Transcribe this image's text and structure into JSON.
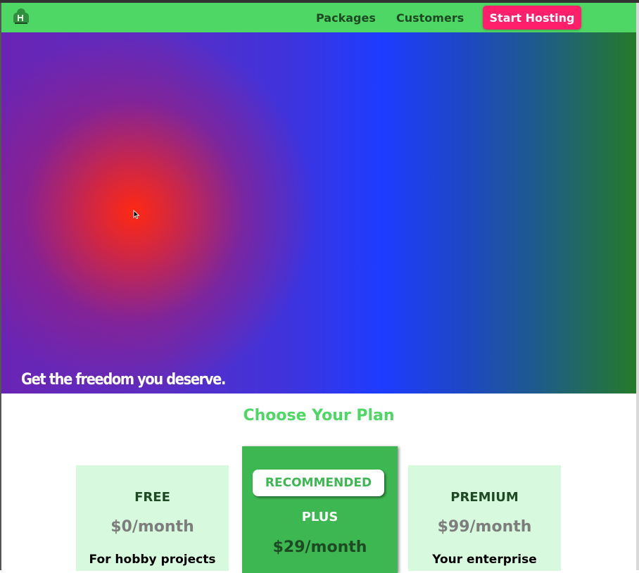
{
  "nav": {
    "logo_icon": "house-cloud-logo-icon",
    "links": [
      "Packages",
      "Customers"
    ],
    "cta_label": "Start Hosting"
  },
  "hero": {
    "title": "Get the freedom you deserve."
  },
  "plans": {
    "heading": "Choose Your Plan",
    "free": {
      "name": "FREE",
      "price": "$0/month",
      "description": "For hobby projects"
    },
    "plus": {
      "badge": "RECOMMENDED",
      "name": "PLUS",
      "price": "$29/month"
    },
    "premium": {
      "name": "PREMIUM",
      "price": "$99/month",
      "description": "Your enterprise"
    }
  },
  "colors": {
    "nav_green": "#4fd765",
    "nav_text": "#1d4a23",
    "cta_pink": "#ff1f6b",
    "plan_light": "#d7f9dd",
    "plan_accent": "#3db751",
    "price_gray": "#7d7d7d"
  }
}
